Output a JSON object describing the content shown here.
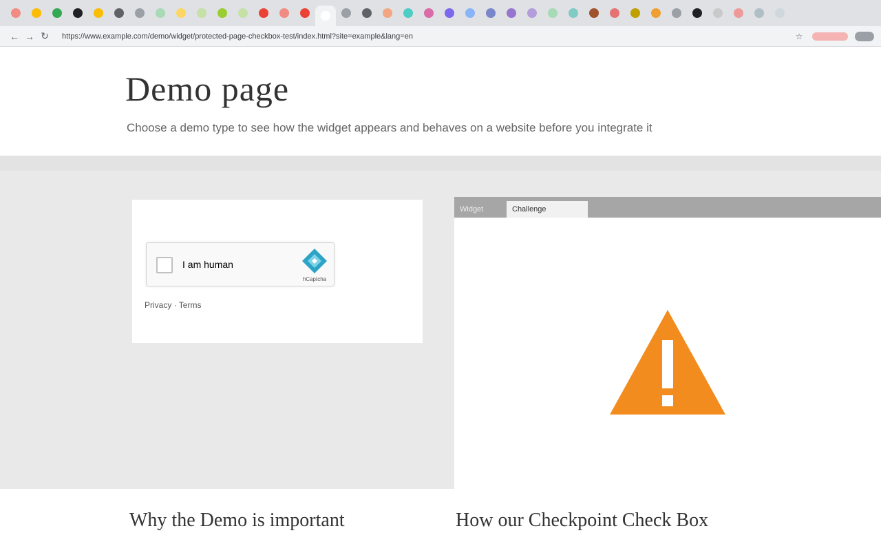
{
  "browser": {
    "tab_colors": [
      "#f28b82",
      "#fbbc04",
      "#34a853",
      "#202124",
      "#fbbc04",
      "#5f6368",
      "#9aa0a6",
      "#a8dab5",
      "#fdd663",
      "#c5e1a5",
      "#9acd32",
      "#c5e1a5",
      "#ea4335",
      "#f28b82",
      "#ea4335",
      "#ffffff",
      "#9aa0a6",
      "#5f6368",
      "#f4a582",
      "#4ecdc4",
      "#d96ba8",
      "#7b68ee",
      "#8ab4f8",
      "#7986cb",
      "#9575cd",
      "#b39ddb",
      "#a8dab5",
      "#80cbc4",
      "#a0522d",
      "#e57373",
      "#c0a000",
      "#f0a030",
      "#9aa0a6",
      "#202124",
      "#c9c9c9",
      "#ef9a9a",
      "#b0bec5",
      "#cfd8dc"
    ],
    "active_tab_index": 15,
    "address": "https://www.example.com/demo/widget/protected-page-checkbox-test/index.html?site=example&lang=en",
    "nav": {
      "back_icon": "back-arrow-icon",
      "forward_icon": "forward-arrow-icon",
      "reload_icon": "reload-icon"
    },
    "toolbar_icons": [
      "star-icon",
      "extension-icon"
    ]
  },
  "page": {
    "title": "Demo page",
    "subtitle": "Choose a demo type to see how the widget appears and behaves on a website before you integrate it"
  },
  "widget": {
    "checkbox_label": "I am human",
    "brand": "hCaptcha",
    "note": "Privacy · Terms"
  },
  "preview": {
    "tabs": [
      "Widget",
      "Challenge"
    ],
    "warning_icon": "warning-triangle-icon",
    "warning_color": "#f28c1e"
  },
  "sections": {
    "left_heading": "Why the Demo is important",
    "right_heading": "How our Checkpoint Check Box"
  }
}
